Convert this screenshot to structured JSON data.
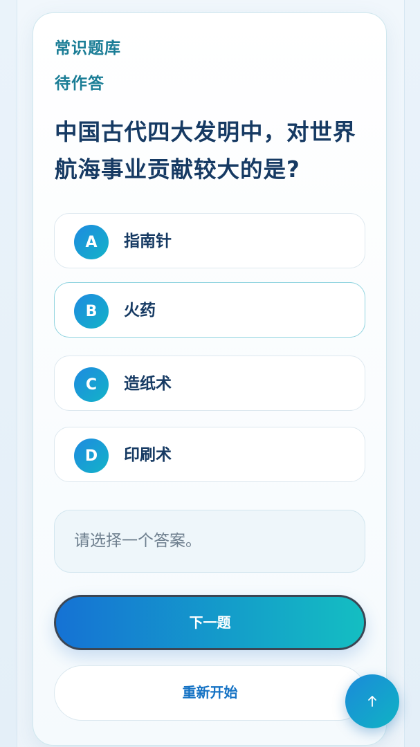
{
  "header": {
    "bank_label": "常识题库",
    "status_label": "待作答"
  },
  "question": {
    "text": "中国古代四大发明中，对世界航海事业贡献较大的是?"
  },
  "options": [
    {
      "letter": "A",
      "text": "指南针"
    },
    {
      "letter": "B",
      "text": "火药"
    },
    {
      "letter": "C",
      "text": "造纸术"
    },
    {
      "letter": "D",
      "text": "印刷术"
    }
  ],
  "feedback": {
    "text": "请选择一个答案。"
  },
  "actions": {
    "next_label": "下一题",
    "restart_label": "重新开始"
  },
  "icons": {
    "scroll_top": "arrow-up-icon"
  },
  "colors": {
    "accent_start": "#1572d4",
    "accent_end": "#14bec2",
    "title_text": "#163a63",
    "label_text": "#1a7d96"
  }
}
